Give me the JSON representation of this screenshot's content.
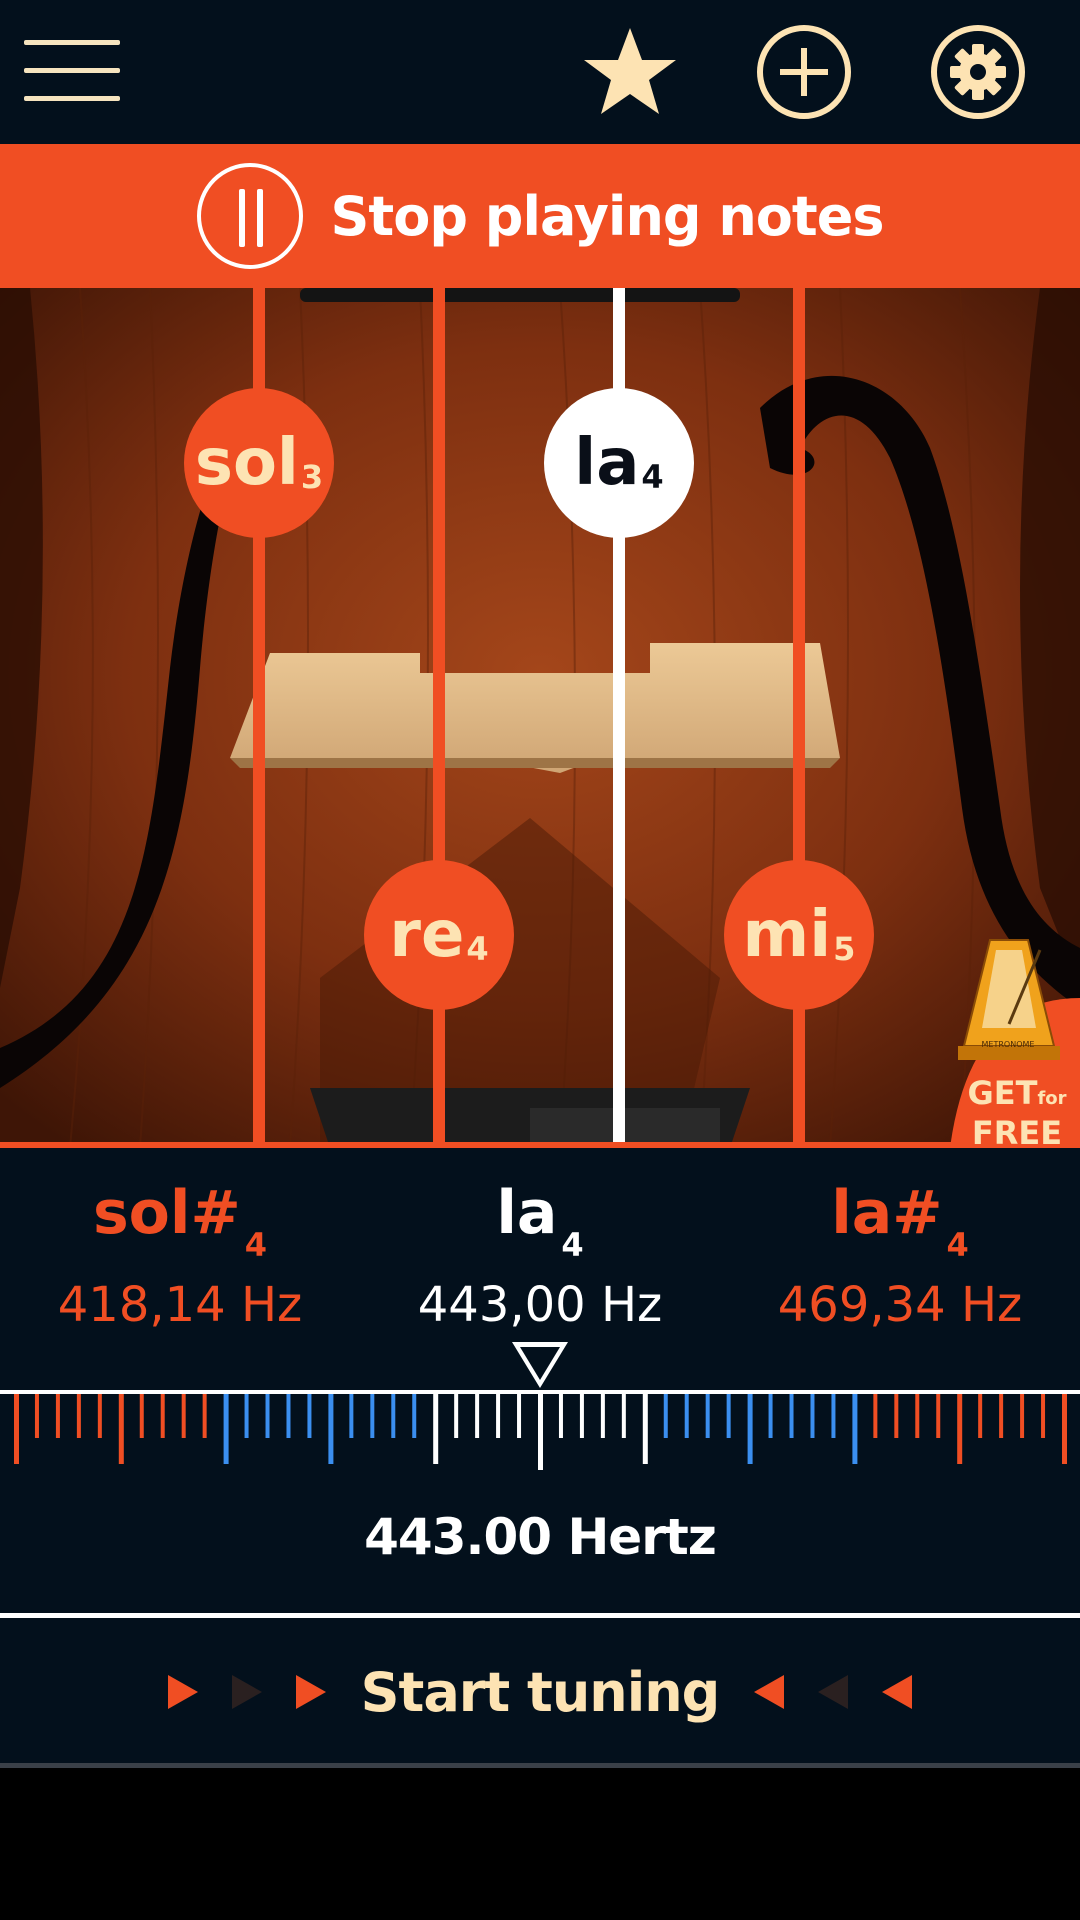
{
  "toolbar": {
    "menu_icon": "hamburger-menu-icon",
    "favorite_icon": "star-icon",
    "add_icon": "plus-circle-icon",
    "settings_icon": "gear-icon"
  },
  "banner": {
    "label": "Stop playing notes",
    "icon": "pause-icon"
  },
  "strings": [
    {
      "note": "sol",
      "octave": "3",
      "active": false
    },
    {
      "note": "re",
      "octave": "4",
      "active": false
    },
    {
      "note": "la",
      "octave": "4",
      "active": true
    },
    {
      "note": "mi",
      "octave": "5",
      "active": false
    }
  ],
  "promo": {
    "line1": "GET",
    "line1_small": "for",
    "line2": "FREE",
    "label": "METRONOME"
  },
  "detected": {
    "prev": {
      "note": "sol#",
      "octave": "4",
      "freq": "418,14 Hz"
    },
    "current": {
      "note": "la",
      "octave": "4",
      "freq": "443,00 Hz"
    },
    "next": {
      "note": "la#",
      "octave": "4",
      "freq": "469,34 Hz"
    }
  },
  "hertz_readout": "443.00 Hertz",
  "start_button": {
    "label": "Start tuning"
  },
  "colors": {
    "accent": "#f04e23",
    "dark": "#03101c",
    "cream": "#fde3b3",
    "blue": "#3b8ff0"
  }
}
